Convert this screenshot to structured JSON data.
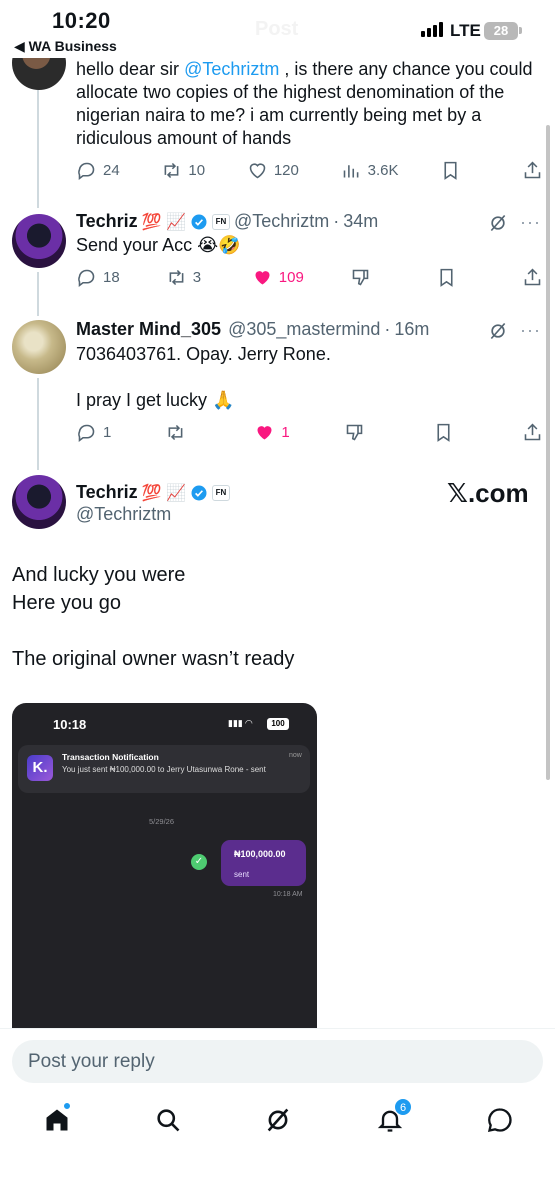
{
  "status_bar": {
    "time": "10:20",
    "back_label": "◀ WA Business",
    "faded_title": "Post",
    "network": "LTE",
    "battery": "28"
  },
  "tweet_1": {
    "text_before": "hello dear sir ",
    "mention": "@Techriztm",
    "text_after": " , is there any chance you could allocate two copies of the highest denomination of the nigerian naira to me? i am currently being met by a ridiculous amount of hands",
    "replies": "24",
    "reposts": "10",
    "likes": "120",
    "views": "3.6K"
  },
  "tweet_2": {
    "name": "Techriz",
    "name_emojis": "💯 📈",
    "badge": "FN",
    "handle": "@Techriztm",
    "time": "34m",
    "text": "Send your Acc 😭🤣",
    "replies": "18",
    "reposts": "3",
    "likes": "109"
  },
  "tweet_3": {
    "name": "Master Mind_305",
    "handle": "@305_mastermind",
    "time": "16m",
    "line_1": "7036403761. Opay. Jerry Rone.",
    "line_2": "I pray I get lucky 🙏",
    "replies": "1",
    "reposts": "",
    "likes": "1"
  },
  "main_post": {
    "name": "Techriz",
    "name_emojis": "💯 📈",
    "badge": "FN",
    "handle": "@Techriztm",
    "watermark": "𝕏.com",
    "line_1": "And lucky you were",
    "line_2": "Here you go",
    "line_3": "The original owner wasn’t ready"
  },
  "embedded_screenshot": {
    "time": "10:18",
    "battery": "100",
    "notification_title": "Transaction Notification",
    "notification_time": "now",
    "notification_body": "You just sent ₦100,000.00 to Jerry Utasunwa Rone - sent",
    "date": "5/29/26",
    "amount": "₦100,000.00",
    "bubble_status": "sent",
    "bubble_time": "10:18 AM"
  },
  "reply_bar": {
    "placeholder": "Post your reply"
  },
  "tab_bar": {
    "notification_count": "6"
  },
  "colors": {
    "accent": "#1d9bf0",
    "like_pink": "#f91880",
    "muted": "#536471"
  }
}
